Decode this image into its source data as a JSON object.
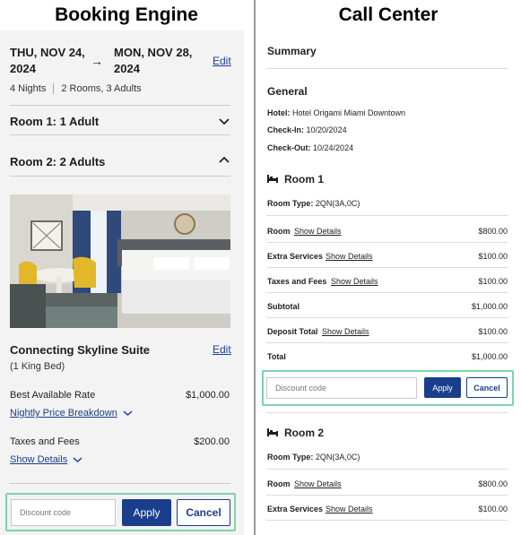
{
  "left": {
    "heading": "Booking Engine",
    "check_in": "THU, NOV 24, 2024",
    "check_out": "MON, NOV 28, 2024",
    "arrow": "→",
    "edit_label": "Edit",
    "nights": "4 Nights",
    "rooms_guests": "2 Rooms, 3 Adults",
    "rooms": [
      {
        "label": "Room 1: 1 Adult",
        "expanded": false
      },
      {
        "label": "Room 2: 2 Adults",
        "expanded": true
      }
    ],
    "chevron_down": "⌄",
    "chevron_up": "⌃",
    "suite_name": "Connecting Skyline Suite",
    "suite_edit": "Edit",
    "bed_type": "(1 King Bed)",
    "best_rate_label": "Best Available Rate",
    "best_rate_value": "$1,000.00",
    "nightly_link": "Nightly Price Breakdown",
    "taxes_label": "Taxes and Fees",
    "taxes_value": "$200.00",
    "show_details": "Show Details",
    "discount_placeholder": "Discount code",
    "apply": "Apply",
    "cancel": "Cancel"
  },
  "right": {
    "heading": "Call Center",
    "summary": "Summary",
    "general": "General",
    "hotel_label": "Hotel:",
    "hotel_value": "Hotel Origami Miami Downtown",
    "checkin_label": "Check-In:",
    "checkin_value": "10/20/2024",
    "checkout_label": "Check-Out:",
    "checkout_value": "10/24/2024",
    "room1": {
      "title": "Room 1",
      "type_label": "Room Type:",
      "type_value": "2QN(3A,0C)",
      "lines": [
        {
          "label": "Room",
          "link": "Show Details",
          "value": "$800.00"
        },
        {
          "label": "Extra Services",
          "link": "Show Details",
          "value": "$100.00"
        },
        {
          "label": "Taxes and Fees",
          "link": "Show Details",
          "value": "$100.00"
        },
        {
          "label": "Subtotal",
          "link": "",
          "value": "$1,000.00"
        },
        {
          "label": "Deposit Total",
          "link": "Show Details",
          "value": "$100.00"
        },
        {
          "label": "Total",
          "link": "",
          "value": "$1,000.00"
        }
      ]
    },
    "discount_placeholder": "Discount code",
    "apply": "Apply",
    "cancel": "Cancel",
    "room2": {
      "title": "Room 2",
      "type_label": "Room Type:",
      "type_value": "2QN(3A,0C)",
      "lines": [
        {
          "label": "Room",
          "link": "Show Details",
          "value": "$800.00"
        },
        {
          "label": "Extra Services",
          "link": "Show Details",
          "value": "$100.00"
        }
      ]
    }
  },
  "colors": {
    "brand": "#1a3e8c",
    "highlight": "#7dd3a8"
  }
}
